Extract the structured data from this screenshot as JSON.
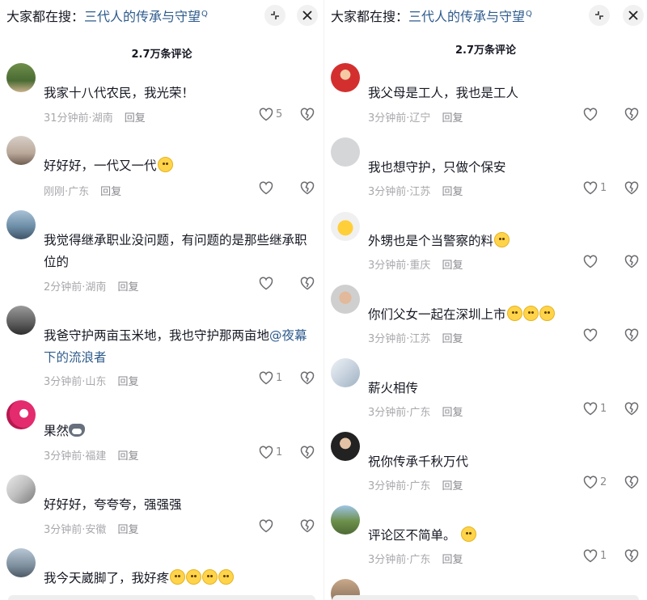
{
  "header": {
    "search_prefix": "大家都在搜：",
    "search_term": "三代人的传承与守望",
    "search_mark": "Q"
  },
  "icons": {
    "collapse": "collapse-arrows-icon",
    "close": "close-icon",
    "like": "heart-outline-icon",
    "dislike": "broken-heart-icon"
  },
  "left": {
    "count": "2.7万条评论",
    "comments": [
      {
        "text": "我家十八代农民，我光荣！",
        "time": "31分钟前",
        "region": "湖南",
        "reply": "回复",
        "likes": "5"
      },
      {
        "text": "好好好，一代又一代",
        "time": "刚刚",
        "region": "广东",
        "reply": "回复",
        "likes": ""
      },
      {
        "text": "我觉得继承职业没问题，有问题的是那些继承职位的",
        "time": "2分钟前",
        "region": "湖南",
        "reply": "回复",
        "likes": ""
      },
      {
        "text": "我爸守护两亩玉米地，我也守护那两亩地",
        "mention": "@夜幕下的流浪者",
        "time": "3分钟前",
        "region": "山东",
        "reply": "回复",
        "likes": "1"
      },
      {
        "text": "果然",
        "time": "3分钟前",
        "region": "福建",
        "reply": "回复",
        "likes": "1"
      },
      {
        "text": "好好好，夸夸夸，强强强",
        "time": "3分钟前",
        "region": "安徽",
        "reply": "回复",
        "likes": ""
      },
      {
        "text": "我今天崴脚了，我好疼"
      }
    ]
  },
  "right": {
    "count": "2.7万条评论",
    "comments": [
      {
        "text": "我父母是工人，我也是工人",
        "time": "3分钟前",
        "region": "辽宁",
        "reply": "回复",
        "likes": ""
      },
      {
        "text": "我也想守护，只做个保安",
        "time": "3分钟前",
        "region": "江苏",
        "reply": "回复",
        "likes": "1"
      },
      {
        "text": "外甥也是个当警察的料",
        "time": "3分钟前",
        "region": "重庆",
        "reply": "回复",
        "likes": ""
      },
      {
        "text": "你们父女一起在深圳上市",
        "time": "3分钟前",
        "region": "江苏",
        "reply": "回复",
        "likes": ""
      },
      {
        "text": "薪火相传",
        "time": "3分钟前",
        "region": "广东",
        "reply": "回复",
        "likes": "1"
      },
      {
        "text": "祝你传承千秋万代",
        "time": "3分钟前",
        "region": "广东",
        "reply": "回复",
        "likes": "2"
      },
      {
        "text": "评论区不简单。",
        "time": "3分钟前",
        "region": "广东",
        "reply": "回复",
        "likes": "1"
      }
    ]
  },
  "colors": {
    "link": "#2e5b8c",
    "meta": "#a8a8ad",
    "text": "#161823"
  }
}
